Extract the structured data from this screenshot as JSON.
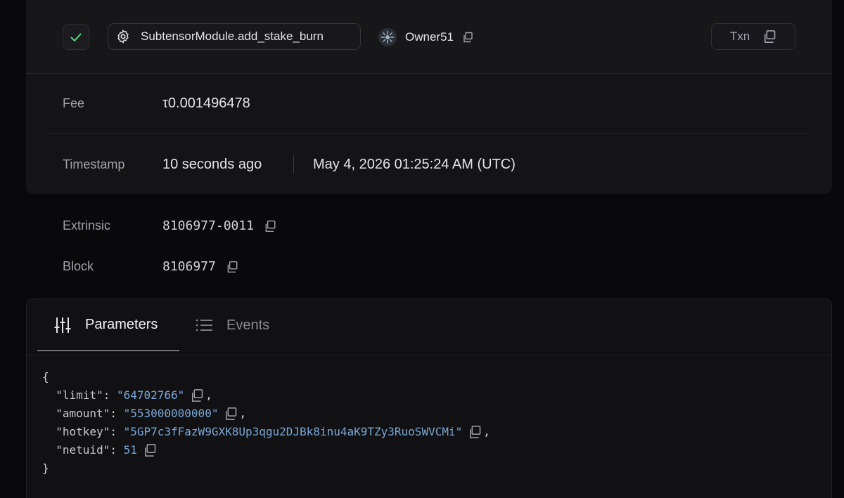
{
  "header": {
    "status": "success",
    "method": "SubtensorModule.add_stake_burn",
    "owner": "Owner51",
    "txn_label": "Txn"
  },
  "details": {
    "fee_label": "Fee",
    "fee_value": "τ0.001496478",
    "timestamp_label": "Timestamp",
    "timestamp_relative": "10 seconds ago",
    "timestamp_absolute": "May 4, 2026 01:25:24 AM (UTC)",
    "extrinsic_label": "Extrinsic",
    "extrinsic_value": "8106977-0011",
    "block_label": "Block",
    "block_value": "8106977"
  },
  "tabs": [
    {
      "label": "Parameters",
      "active": true
    },
    {
      "label": "Events",
      "active": false
    }
  ],
  "params": {
    "open": "{",
    "close": "}",
    "limit_key": "\"limit\"",
    "limit_value": "\"64702766\"",
    "amount_key": "\"amount\"",
    "amount_value": "\"553000000000\"",
    "hotkey_key": "\"hotkey\"",
    "hotkey_value": "\"5GP7c3fFazW9GXK8Up3qgu2DJBk8inu4aK9TZy3RuoSWVCMi\"",
    "netuid_key": "\"netuid\"",
    "netuid_value": "51"
  },
  "colors": {
    "background": "#09090b",
    "card": "#141417",
    "success": "#4ade80",
    "json_value": "#7aa7d6"
  }
}
